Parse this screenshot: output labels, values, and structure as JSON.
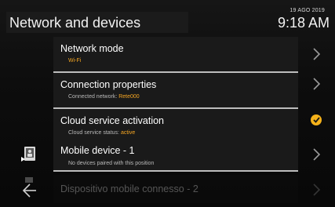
{
  "header": {
    "title": "Network and devices",
    "date": "19 AGO 2019",
    "time": "9:18 AM"
  },
  "rows": [
    {
      "label": "Network mode",
      "sub_prefix": "",
      "sub_value": "Wi-Fi",
      "action": "chevron"
    },
    {
      "label": "Connection properties",
      "sub_prefix": "Connected network:",
      "sub_value": "Rete000",
      "action": "chevron"
    },
    {
      "label": "Cloud service activation",
      "sub_prefix": "Cloud service status:",
      "sub_value": "active",
      "action": "check"
    },
    {
      "label": "Mobile device - 1",
      "sub_prefix": "No devices paired with this position",
      "sub_value": "",
      "action": "chevron"
    },
    {
      "label": "Dispositivo mobile connesso - 2",
      "sub_prefix": "",
      "sub_value": "",
      "action": "chevron"
    }
  ],
  "colors": {
    "accent": "#f5a623",
    "check": "#f5b21a",
    "row_bg": "#1a1a1a",
    "divider": "#bdbdbd"
  },
  "icons": {
    "row_action": "chevron-right-icon",
    "active_status": "check-circle-icon",
    "mobile_device": "mobile-device-icon",
    "back": "back-arrow-icon"
  }
}
